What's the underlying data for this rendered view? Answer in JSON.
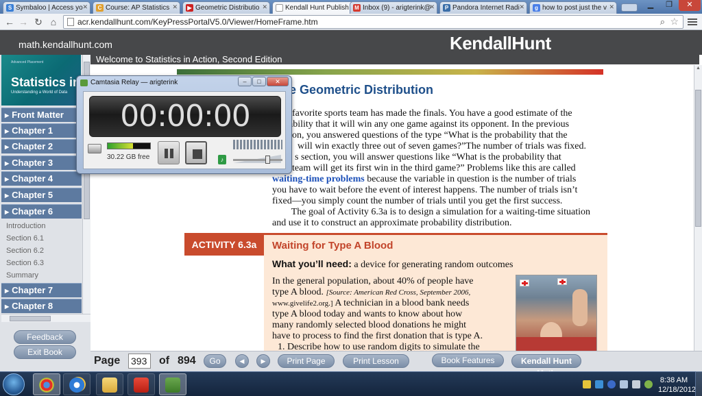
{
  "browser": {
    "tabs": [
      {
        "label": "Symbaloo | Access yo",
        "color": "#3a7fd6",
        "active": false
      },
      {
        "label": "Course: AP Statistics",
        "color": "#e0a030",
        "active": false
      },
      {
        "label": "Geometric Distributio",
        "color": "#cc2222",
        "active": false
      },
      {
        "label": "Kendall Hunt Publish",
        "color": "#ffffff",
        "active": true
      },
      {
        "label": "Inbox (9) - arigterink@",
        "color": "#d43a2f",
        "active": false
      },
      {
        "label": "Pandora Internet Radi",
        "color": "#3b6ea8",
        "active": false
      },
      {
        "label": "how to post just the v",
        "color": "#4a7fe8",
        "active": false
      }
    ],
    "url": "acr.kendallhunt.com/KeyPressPortalV5.0/Viewer/HomeFrame.htm"
  },
  "site": {
    "domain_text": "math.kendallhunt.com",
    "logo": "KendallHunt",
    "welcome": "Welcome to Statistics in Action, Second Edition"
  },
  "sidebar": {
    "cover": {
      "small": "Advanced Placement",
      "title": "Statistics in",
      "sub": "Understanding a World of Data"
    },
    "items": [
      {
        "label": "Front Matter"
      },
      {
        "label": "Chapter 1"
      },
      {
        "label": "Chapter 2"
      },
      {
        "label": "Chapter 3"
      },
      {
        "label": "Chapter 4"
      },
      {
        "label": "Chapter 5"
      },
      {
        "label": "Chapter 6"
      }
    ],
    "subitems": [
      {
        "label": "Introduction"
      },
      {
        "label": "Section 6.1"
      },
      {
        "label": "Section 6.2"
      },
      {
        "label": "Section 6.3"
      },
      {
        "label": "Summary"
      }
    ],
    "lower_items": [
      {
        "label": "Chapter 7"
      },
      {
        "label": "Chapter 8"
      }
    ],
    "feedback": "Feedback",
    "exit": "Exit Book"
  },
  "content": {
    "title": "e Geometric Distribution",
    "para_lines": [
      "favorite sports team has made the finals. You have a good estimate of the",
      "ability that it will win any one game against its opponent. In the previous",
      "on, you answered questions of the type “What is the probability that the",
      "will win exactly three out of seven games?”The number of trials was fixed.",
      "s section, you will answer questions like “What is the probability that",
      "team will get its first win in the third game?” Problems like this are called"
    ],
    "keyword": "waiting-time problems",
    "keyword_tail": " because the variable in question is the number of trials",
    "para_lines2": [
      "you have to wait before the event of interest happens. The number of trials isn’t",
      "fixed—you simply count the number of trials until you get the first success.",
      "        The goal of Activity 6.3a is to design a simulation for a waiting-time situation",
      "and use it to construct an approximate probability distribution."
    ],
    "activity": {
      "label": "ACTIVITY 6.3a",
      "title": "Waiting for Type A Blood",
      "needs_label": "What you’ll need:",
      "needs_text": " a device for generating random outcomes",
      "body_lines": [
        "In the general population, about 40% of people have",
        "many randomly selected blood donations he might",
        "have to process to find the first donation that is type A."
      ],
      "body_line2a": "type A blood. ",
      "source_small": "[Source: American Red Cross, September 2006,",
      "source_small2": "www.givelife2.org.]",
      "body_line3b": " A technician in a blood bank needs",
      "body_line4": "type A blood today and wants to know about how",
      "cut_line": "1.  Describe how to use random digits to simulate the"
    }
  },
  "pager": {
    "page_label": "Page",
    "page_value": "393",
    "of_label": "of",
    "total": "894",
    "go": "Go",
    "print_page": "Print Page",
    "print_lesson": "Print Lesson",
    "book_features": "Book Features",
    "kh_math": "Kendall Hunt Math"
  },
  "camtasia": {
    "title": "Camtasia Relay — arigterink",
    "timer": "00:00:00",
    "free_space": "30.22 GB free",
    "disk_level": 0.6,
    "volume_level": 0.72
  },
  "taskbar": {
    "time": "8:38 AM",
    "date": "12/18/2012",
    "apps": [
      "chrome-icon",
      "ie-icon",
      "explorer-icon",
      "pdf-icon",
      "camtasia-icon"
    ]
  }
}
